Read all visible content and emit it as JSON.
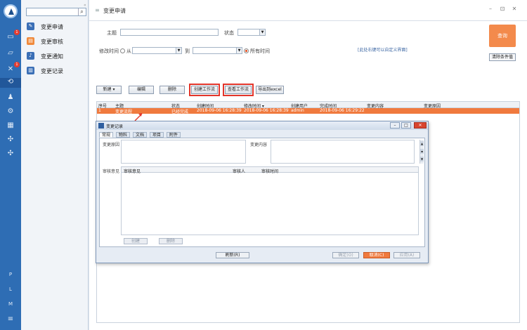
{
  "rail": {
    "badges": [
      "1",
      "1"
    ],
    "bottom_letters": [
      "P",
      "L",
      "M"
    ]
  },
  "menu": {
    "collapse": "«",
    "items": [
      {
        "label": "变更申请",
        "color": "#3b6fb6",
        "icon": "edit-icon"
      },
      {
        "label": "变更审核",
        "color": "#f08a3c",
        "icon": "audit-icon"
      },
      {
        "label": "变更通知",
        "color": "#3b6fb6",
        "icon": "bell-icon"
      },
      {
        "label": "变更记录",
        "color": "#3b6fb6",
        "icon": "record-icon"
      }
    ]
  },
  "titlebar": {
    "menu_icon": "≡",
    "title": "变更申请",
    "minimize": "–",
    "maximize": "⊡",
    "close": "✕"
  },
  "filter": {
    "subject_label": "主题",
    "status_label": "状态",
    "modify_time_label": "修改时间",
    "from_label": "从",
    "to_label": "到",
    "all_time_label": "所有时间",
    "hint": "[此处右键可以自定义界面]",
    "query_button": "查询",
    "clear_button": "清除条件值"
  },
  "toolbar": {
    "new": "新建 ▾",
    "edit": "编辑",
    "delete": "删除",
    "create_workflow": "创建工作流",
    "view_workflow": "查看工作流",
    "export_excel": "导出到excel"
  },
  "grid": {
    "columns": [
      "序号",
      "主题",
      "状态",
      "创建时间",
      "修改时间 ▾",
      "创建用户",
      "完成时间",
      "变更内容",
      "变更原因"
    ],
    "rows": [
      [
        "1",
        "变更流程",
        "已经完成",
        "2018-09-06 16:28:39",
        "2018-09-06 16:28:39",
        "admin",
        "2018-09-06 16:29:22",
        "",
        ""
      ]
    ]
  },
  "dialog": {
    "title": "变更记录",
    "minimize": "–",
    "maximize": "□",
    "close": "✕",
    "tabs": [
      "常规",
      "物料",
      "文档",
      "项目",
      "附件"
    ],
    "change_reason_label": "变更原因",
    "change_content_label": "变更内容",
    "review_opinion_label": "审核意见",
    "subgrid_columns": [
      "审核意见",
      "审核人",
      "审核时间"
    ],
    "sub_create": "创建",
    "sub_delete": "删除",
    "refresh": "刷新(R)",
    "ok": "确定(O)",
    "cancel": "取消(C)",
    "apply": "应用(A)",
    "cancel_color": "#f07a3e"
  }
}
